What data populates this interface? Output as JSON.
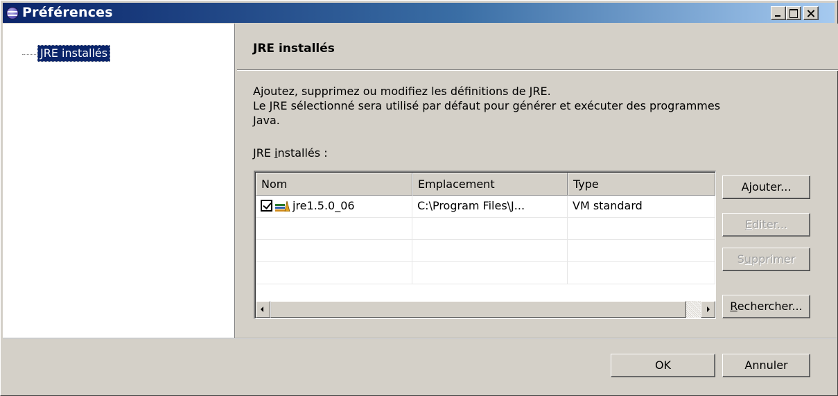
{
  "window": {
    "title": "Préférences",
    "minimize_icon": "minimize-icon",
    "maximize_icon": "maximize-icon",
    "close_icon": "close-icon"
  },
  "tree": {
    "items": [
      {
        "label": "JRE installés",
        "selected": true
      }
    ]
  },
  "page": {
    "title": "JRE installés",
    "description": [
      "Ajoutez, supprimez ou modifiez les définitions de JRE.",
      "Le JRE sélectionné sera utilisé par défaut pour générer et exécuter des programmes",
      "Java."
    ],
    "list_label_prefix": "JRE ",
    "list_label_mnemonic": "i",
    "list_label_suffix": "nstallés :"
  },
  "table": {
    "columns": [
      "Nom",
      "Emplacement",
      "Type"
    ],
    "rows": [
      {
        "checked": true,
        "icon": "jre-library-icon",
        "name": "jre1.5.0_06",
        "location": "C:\\Program Files\\J...",
        "type": "VM standard"
      }
    ]
  },
  "buttons": {
    "add": {
      "pre": "A",
      "mn": "j",
      "post": "outer..."
    },
    "edit": {
      "pre": "",
      "mn": "E",
      "post": "diter..."
    },
    "remove": {
      "pre": "S",
      "mn": "u",
      "post": "pprimer"
    },
    "search": {
      "pre": "",
      "mn": "R",
      "post": "echercher..."
    },
    "ok": "OK",
    "cancel": "Annuler"
  },
  "colors": {
    "titlebar_start": "#0a246a",
    "titlebar_end": "#a6caf0",
    "dialog_bg": "#d4d0c8",
    "selection": "#0a246a"
  }
}
